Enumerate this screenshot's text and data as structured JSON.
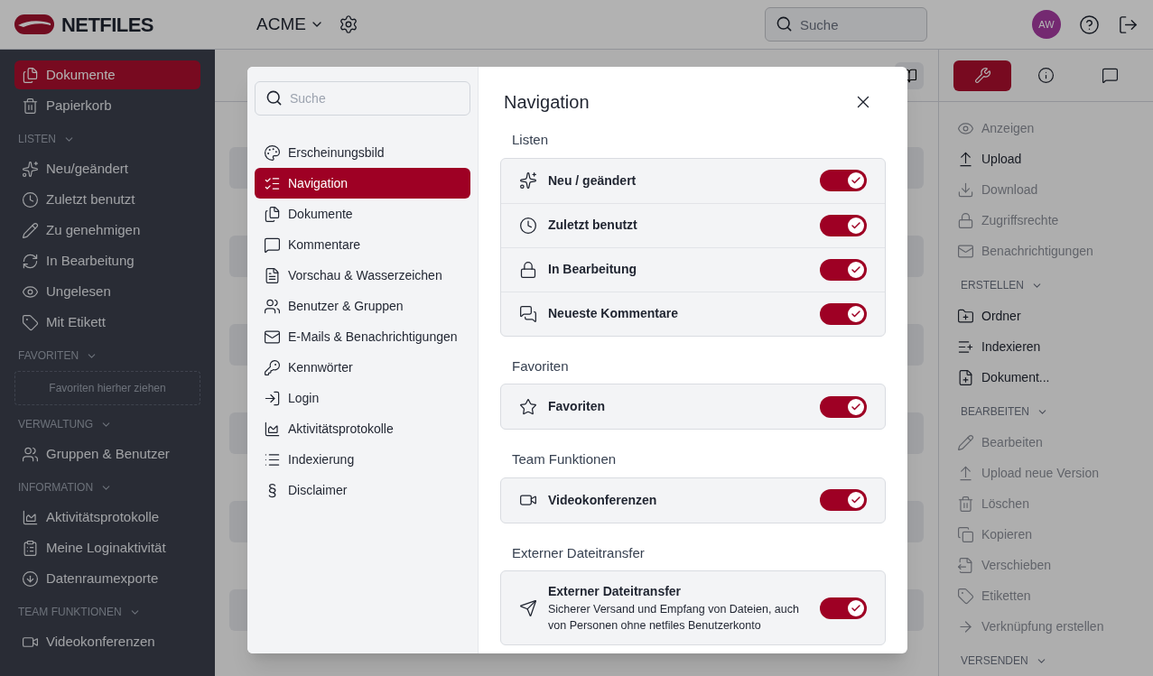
{
  "header": {
    "logo": "NETFILES",
    "workspace": "ACME",
    "search": {
      "placeholder": "Suche"
    },
    "avatar": "AW"
  },
  "sidebar": {
    "items": [
      {
        "label": "Dokumente",
        "selected": true
      },
      {
        "label": "Papierkorb",
        "selected": false
      }
    ],
    "sections": [
      {
        "title": "LISTEN",
        "items": [
          {
            "label": "Neu/geändert",
            "selected": false
          },
          {
            "label": "Zuletzt benutzt",
            "selected": false
          },
          {
            "label": "Zu genehmigen",
            "selected": false
          },
          {
            "label": "In Bearbeitung",
            "selected": false
          },
          {
            "label": "Ungelesen",
            "selected": false
          },
          {
            "label": "Mit Etikett",
            "selected": false
          }
        ]
      },
      {
        "title": "FAVORITEN",
        "dropzone": "Favoriten hierher ziehen"
      },
      {
        "title": "VERWALTUNG",
        "items": [
          {
            "label": "Gruppen & Benutzer",
            "selected": false
          }
        ]
      },
      {
        "title": "INFORMATION",
        "items": [
          {
            "label": "Aktivitätsprotokolle",
            "selected": false
          },
          {
            "label": "Meine Loginaktivität",
            "selected": false
          },
          {
            "label": "Datenraumexporte",
            "selected": false
          }
        ]
      },
      {
        "title": "TEAM FUNKTIONEN",
        "items": [
          {
            "label": "Videokonferenzen",
            "selected": false
          }
        ]
      }
    ]
  },
  "right_panel": {
    "tabs": [
      {
        "selected": true
      },
      {
        "selected": false
      },
      {
        "selected": false
      }
    ],
    "items": [
      {
        "label": "Anzeigen",
        "disabled": true
      },
      {
        "label": "Upload",
        "disabled": false
      },
      {
        "label": "Download",
        "disabled": true
      },
      {
        "label": "Zugriffsrechte",
        "disabled": true
      },
      {
        "label": "Benachrichtigungen",
        "disabled": true
      }
    ],
    "sections": [
      {
        "title": "ERSTELLEN",
        "items": [
          {
            "label": "Ordner",
            "disabled": false
          },
          {
            "label": "Indexieren",
            "disabled": false
          },
          {
            "label": "Dokument...",
            "disabled": false
          }
        ]
      },
      {
        "title": "BEARBEITEN",
        "items": [
          {
            "label": "Bearbeiten",
            "disabled": true
          },
          {
            "label": "Upload neue Version",
            "disabled": true
          },
          {
            "label": "Löschen",
            "disabled": true
          },
          {
            "label": "Kopieren",
            "disabled": true
          },
          {
            "label": "Verschieben",
            "disabled": true
          },
          {
            "label": "Etiketten",
            "disabled": true
          },
          {
            "label": "Verknüpfung erstellen",
            "disabled": true
          }
        ]
      },
      {
        "title": "VERSENDEN"
      }
    ]
  },
  "dialog": {
    "search": {
      "placeholder": "Suche"
    },
    "menu": [
      {
        "label": "Erscheinungsbild",
        "selected": false
      },
      {
        "label": "Navigation",
        "selected": true
      },
      {
        "label": "Dokumente",
        "selected": false
      },
      {
        "label": "Kommentare",
        "selected": false
      },
      {
        "label": "Vorschau & Wasserzeichen",
        "selected": false
      },
      {
        "label": "Benutzer & Gruppen",
        "selected": false
      },
      {
        "label": "E-Mails & Benachrichtigungen",
        "selected": false
      },
      {
        "label": "Kennwörter",
        "selected": false
      },
      {
        "label": "Login",
        "selected": false
      },
      {
        "label": "Aktivitätsprotokolle",
        "selected": false
      },
      {
        "label": "Indexierung",
        "selected": false
      },
      {
        "label": "Disclaimer",
        "selected": false,
        "icon_text": "§"
      }
    ],
    "title": "Navigation",
    "sections": [
      {
        "title": "Listen",
        "rows": [
          {
            "label": "Neu / geändert",
            "on": true
          },
          {
            "label": "Zuletzt benutzt",
            "on": true
          },
          {
            "label": "In Bearbeitung",
            "on": true
          },
          {
            "label": "Neueste Kommentare",
            "on": true
          }
        ]
      },
      {
        "title": "Favoriten",
        "rows": [
          {
            "label": "Favoriten",
            "on": true
          }
        ]
      },
      {
        "title": "Team Funktionen",
        "rows": [
          {
            "label": "Videokonferenzen",
            "on": true
          }
        ]
      },
      {
        "title": "Externer Dateitransfer",
        "rows": [
          {
            "label": "Externer Dateitransfer",
            "description": "Sicherer Versand und Empfang von Dateien, auch von Personen ohne netfiles Benutzerkonto",
            "on": true
          }
        ]
      }
    ]
  }
}
